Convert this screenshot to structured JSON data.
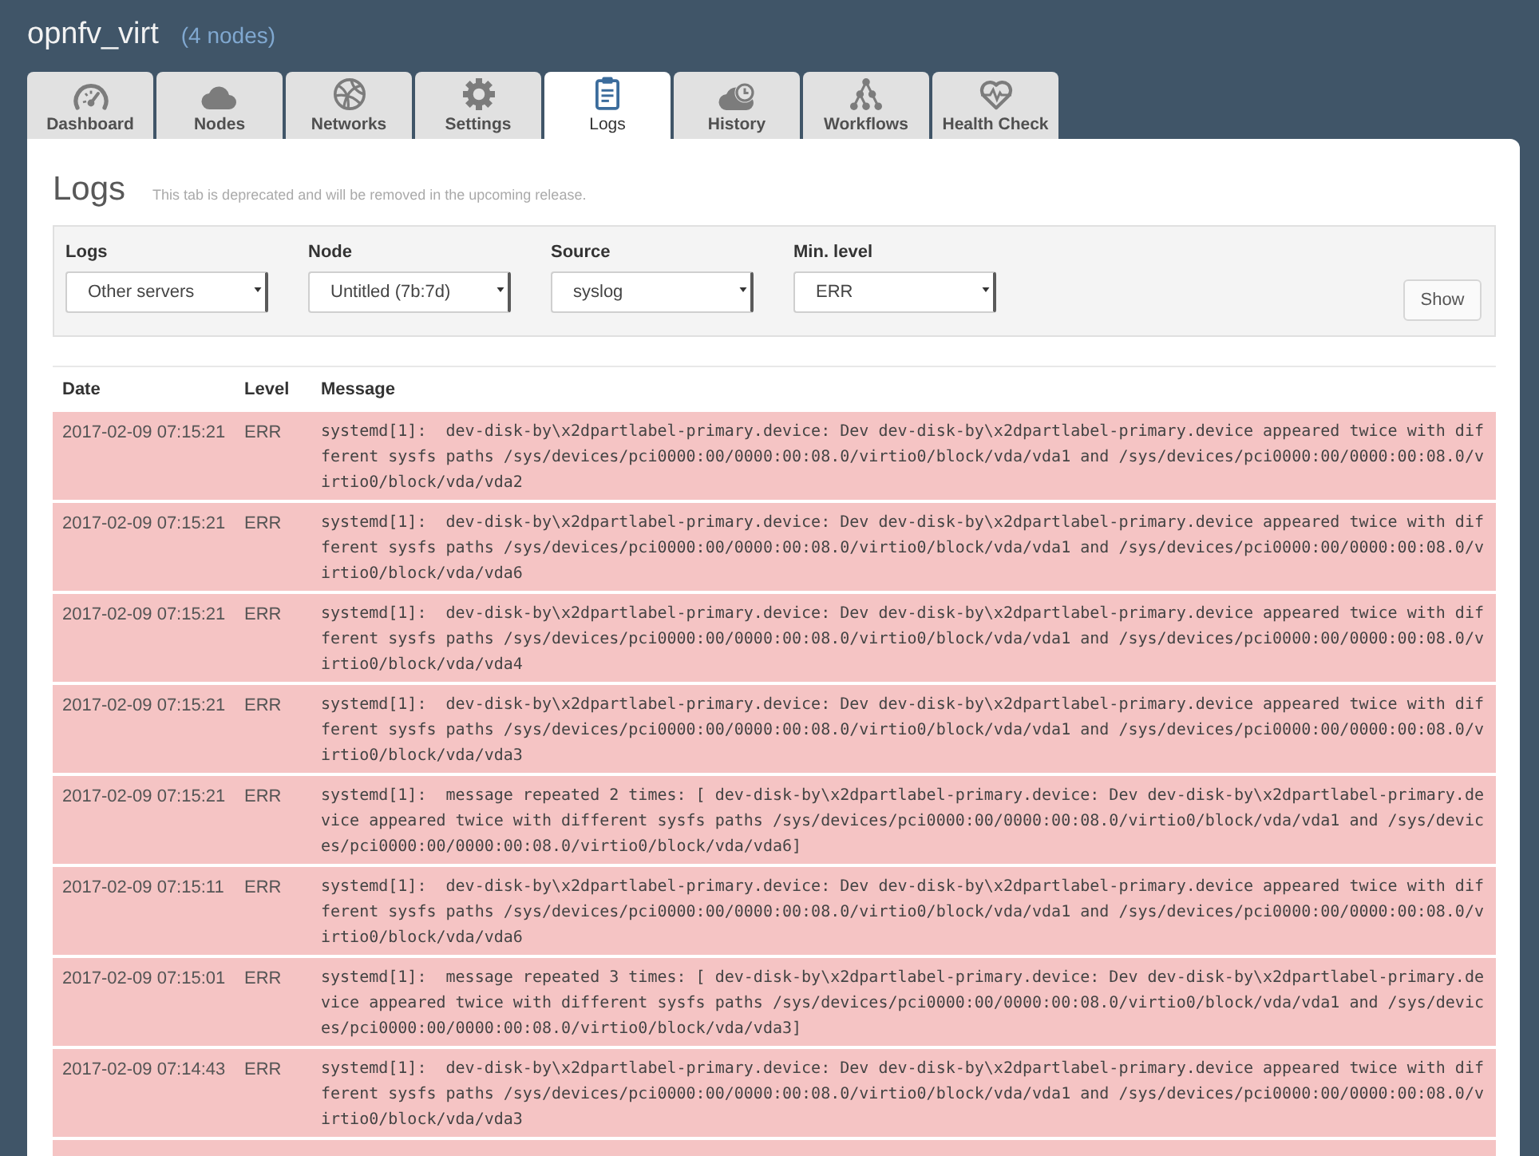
{
  "header": {
    "title": "opnfv_virt",
    "node_count": "(4 nodes)"
  },
  "tabs": [
    {
      "label": "Dashboard",
      "kind": "dashboard",
      "selected": false
    },
    {
      "label": "Nodes",
      "kind": "nodes",
      "selected": false
    },
    {
      "label": "Networks",
      "kind": "networks",
      "selected": false
    },
    {
      "label": "Settings",
      "kind": "settings",
      "selected": false
    },
    {
      "label": "Logs",
      "kind": "logs",
      "selected": true
    },
    {
      "label": "History",
      "kind": "history",
      "selected": false
    },
    {
      "label": "Workflows",
      "kind": "workflows",
      "selected": false
    },
    {
      "label": "Health Check",
      "kind": "health",
      "selected": false
    }
  ],
  "page": {
    "title": "Logs",
    "notice": "This tab is deprecated and will be removed in the upcoming release."
  },
  "filters": [
    {
      "label": "Logs",
      "value": "Other servers"
    },
    {
      "label": "Node",
      "value": "Untitled (7b:7d)"
    },
    {
      "label": "Source",
      "value": "syslog"
    },
    {
      "label": "Min. level",
      "value": "ERR"
    }
  ],
  "show_button": "Show",
  "table": {
    "columns": [
      "Date",
      "Level",
      "Message"
    ],
    "rows": [
      {
        "date": "2017-02-09 07:15:21",
        "level": "ERR",
        "message": "systemd[1]:  dev-disk-by\\x2dpartlabel-primary.device: Dev dev-disk-by\\x2dpartlabel-primary.device appeared twice with different sysfs paths /sys/devices/pci0000:00/0000:00:08.0/virtio0/block/vda/vda1 and /sys/devices/pci0000:00/0000:00:08.0/virtio0/block/vda/vda2"
      },
      {
        "date": "2017-02-09 07:15:21",
        "level": "ERR",
        "message": "systemd[1]:  dev-disk-by\\x2dpartlabel-primary.device: Dev dev-disk-by\\x2dpartlabel-primary.device appeared twice with different sysfs paths /sys/devices/pci0000:00/0000:00:08.0/virtio0/block/vda/vda1 and /sys/devices/pci0000:00/0000:00:08.0/virtio0/block/vda/vda6"
      },
      {
        "date": "2017-02-09 07:15:21",
        "level": "ERR",
        "message": "systemd[1]:  dev-disk-by\\x2dpartlabel-primary.device: Dev dev-disk-by\\x2dpartlabel-primary.device appeared twice with different sysfs paths /sys/devices/pci0000:00/0000:00:08.0/virtio0/block/vda/vda1 and /sys/devices/pci0000:00/0000:00:08.0/virtio0/block/vda/vda4"
      },
      {
        "date": "2017-02-09 07:15:21",
        "level": "ERR",
        "message": "systemd[1]:  dev-disk-by\\x2dpartlabel-primary.device: Dev dev-disk-by\\x2dpartlabel-primary.device appeared twice with different sysfs paths /sys/devices/pci0000:00/0000:00:08.0/virtio0/block/vda/vda1 and /sys/devices/pci0000:00/0000:00:08.0/virtio0/block/vda/vda3"
      },
      {
        "date": "2017-02-09 07:15:21",
        "level": "ERR",
        "message": "systemd[1]:  message repeated 2 times: [ dev-disk-by\\x2dpartlabel-primary.device: Dev dev-disk-by\\x2dpartlabel-primary.device appeared twice with different sysfs paths /sys/devices/pci0000:00/0000:00:08.0/virtio0/block/vda/vda1 and /sys/devices/pci0000:00/0000:00:08.0/virtio0/block/vda/vda6]"
      },
      {
        "date": "2017-02-09 07:15:11",
        "level": "ERR",
        "message": "systemd[1]:  dev-disk-by\\x2dpartlabel-primary.device: Dev dev-disk-by\\x2dpartlabel-primary.device appeared twice with different sysfs paths /sys/devices/pci0000:00/0000:00:08.0/virtio0/block/vda/vda1 and /sys/devices/pci0000:00/0000:00:08.0/virtio0/block/vda/vda6"
      },
      {
        "date": "2017-02-09 07:15:01",
        "level": "ERR",
        "message": "systemd[1]:  message repeated 3 times: [ dev-disk-by\\x2dpartlabel-primary.device: Dev dev-disk-by\\x2dpartlabel-primary.device appeared twice with different sysfs paths /sys/devices/pci0000:00/0000:00:08.0/virtio0/block/vda/vda1 and /sys/devices/pci0000:00/0000:00:08.0/virtio0/block/vda/vda3]"
      },
      {
        "date": "2017-02-09 07:14:43",
        "level": "ERR",
        "message": "systemd[1]:  dev-disk-by\\x2dpartlabel-primary.device: Dev dev-disk-by\\x2dpartlabel-primary.device appeared twice with different sysfs paths /sys/devices/pci0000:00/0000:00:08.0/virtio0/block/vda/vda1 and /sys/devices/pci0000:00/0000:00:08.0/virtio0/block/vda/vda3"
      }
    ]
  }
}
